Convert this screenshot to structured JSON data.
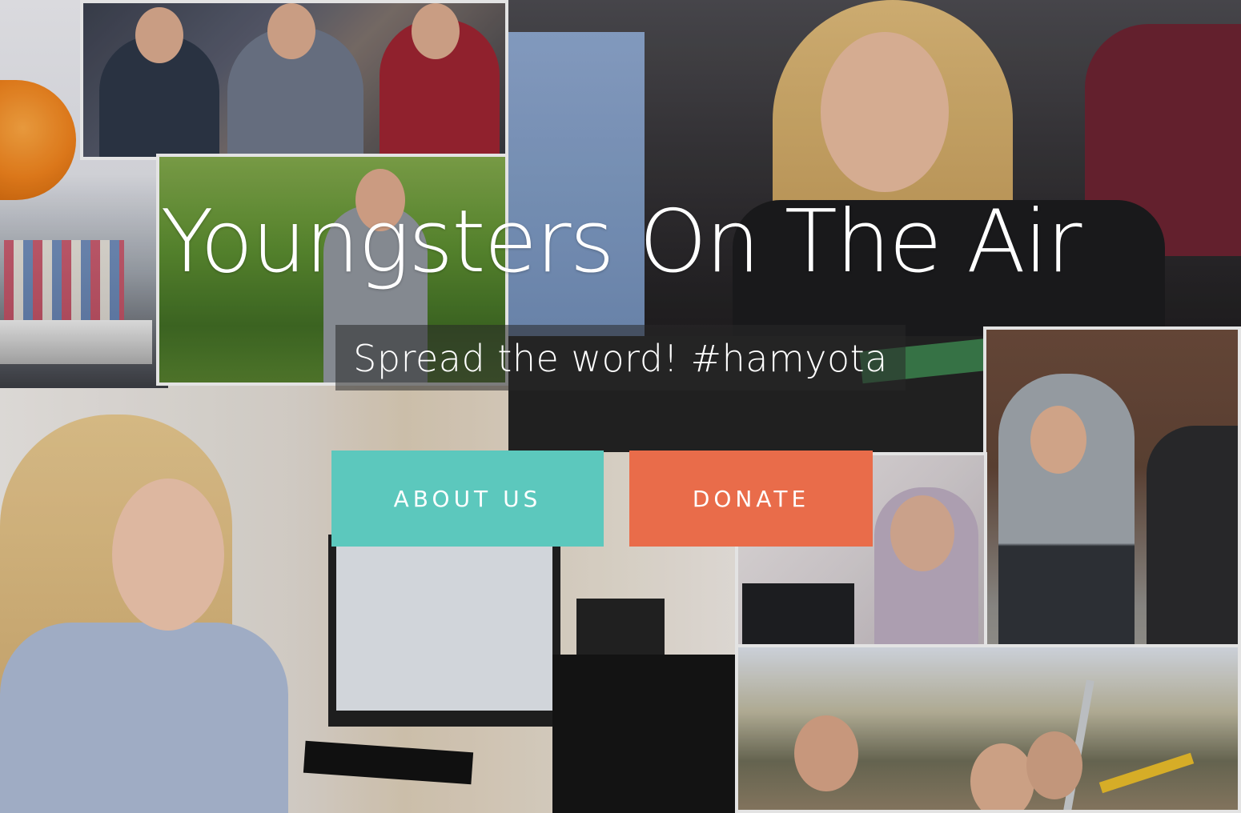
{
  "hero": {
    "title": "Youngsters On The Air",
    "subtitle": "Spread the word! #hamyota"
  },
  "buttons": {
    "about_label": "ABOUT US",
    "donate_label": "DONATE"
  },
  "colors": {
    "about_button": "#5cc8bd",
    "donate_button": "#e96c4a",
    "text": "#ffffff"
  }
}
